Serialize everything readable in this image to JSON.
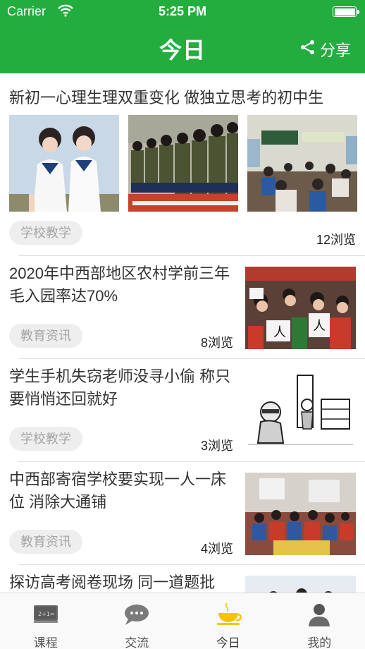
{
  "status_bar": {
    "carrier": "Carrier",
    "time": "5:25 PM"
  },
  "nav": {
    "title": "今日",
    "share_label": "分享"
  },
  "colors": {
    "brand_green": "#23ad3f",
    "tag_bg": "#eeeeee",
    "tag_text": "#a6a6a6",
    "active_tab_icon": "#f5c400"
  },
  "articles": [
    {
      "title": "新初一心理生理双重变化 做独立思考的初中生",
      "tag": "学校教学",
      "views": "12浏览"
    },
    {
      "title": "2020年中西部地区农村学前三年毛入园率达70%",
      "tag": "教育资讯",
      "views": "8浏览"
    },
    {
      "title": "学生手机失窃老师没寻小偷 称只要悄悄还回就好",
      "tag": "学校教学",
      "views": "3浏览"
    },
    {
      "title": "中西部寄宿学校要实现一人一床位 消除大通铺",
      "tag": "教育资讯",
      "views": "4浏览"
    },
    {
      "title": "探访高考阅卷现场 同一道题批"
    }
  ],
  "tabbar": [
    {
      "label": "课程",
      "icon": "blackboard-icon"
    },
    {
      "label": "交流",
      "icon": "chat-bubble-icon"
    },
    {
      "label": "今日",
      "icon": "coffee-cup-icon",
      "active": true
    },
    {
      "label": "我的",
      "icon": "user-profile-icon"
    }
  ]
}
